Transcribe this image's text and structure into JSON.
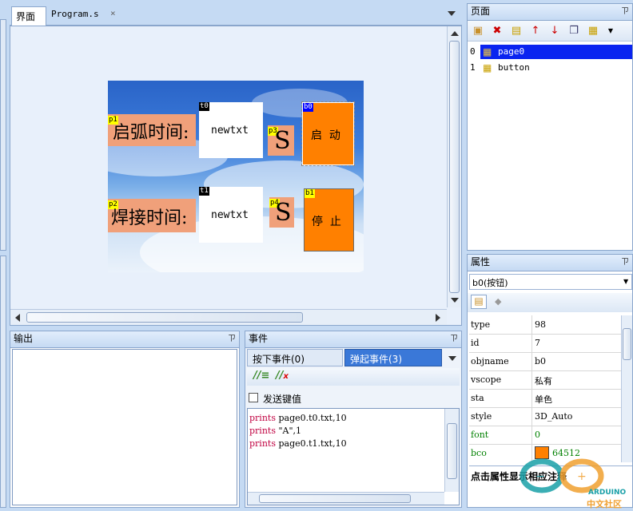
{
  "editor": {
    "tabs": [
      {
        "label": "界面"
      },
      {
        "label": "Program.s"
      }
    ],
    "close_glyph": "×"
  },
  "canvas": {
    "components": {
      "p1": {
        "id": "p1",
        "text": "启弧时间:"
      },
      "p2": {
        "id": "p2",
        "text": "焊接时间:"
      },
      "t0": {
        "id": "t0",
        "text": "newtxt"
      },
      "t1": {
        "id": "t1",
        "text": "newtxt"
      },
      "p3": {
        "id": "p3",
        "text": "S"
      },
      "p4": {
        "id": "p4",
        "text": "S"
      },
      "b0": {
        "id": "b0",
        "text": "启  动"
      },
      "b1": {
        "id": "b1",
        "text": "停  止"
      }
    }
  },
  "pages_panel": {
    "title": "页面",
    "items": [
      {
        "index": "0",
        "name": "page0",
        "selected": true
      },
      {
        "index": "1",
        "name": "button",
        "selected": false
      }
    ]
  },
  "props_panel": {
    "title": "属性",
    "selected_object": "b0(按钮)",
    "rows": [
      {
        "key": "type",
        "value": "98"
      },
      {
        "key": "id",
        "value": "7"
      },
      {
        "key": "objname",
        "value": "b0"
      },
      {
        "key": "vscope",
        "value": "私有"
      },
      {
        "key": "sta",
        "value": "单色"
      },
      {
        "key": "style",
        "value": "3D_Auto"
      },
      {
        "key": "font",
        "value": "0"
      },
      {
        "key": "bco",
        "value": "64512"
      }
    ],
    "hint": "点击属性显示相应注释",
    "colors": {
      "bco": "#ff8000",
      "green_key": "#008000"
    }
  },
  "output_panel": {
    "title": "输出"
  },
  "events_panel": {
    "title": "事件",
    "tabs": [
      {
        "label": "按下事件(0)"
      },
      {
        "label": "弹起事件(3)"
      }
    ],
    "checkbox_label": "发送键值",
    "code": [
      {
        "kw": "prints",
        "args": " page0.t0.txt,10"
      },
      {
        "kw": "prints",
        "args": " \"A\",1"
      },
      {
        "kw": "prints",
        "args": " page0.t1.txt,10"
      }
    ]
  },
  "watermark": {
    "text": "中文社区",
    "brand": "ARDUINO"
  },
  "pin_glyph": "ㄗ"
}
